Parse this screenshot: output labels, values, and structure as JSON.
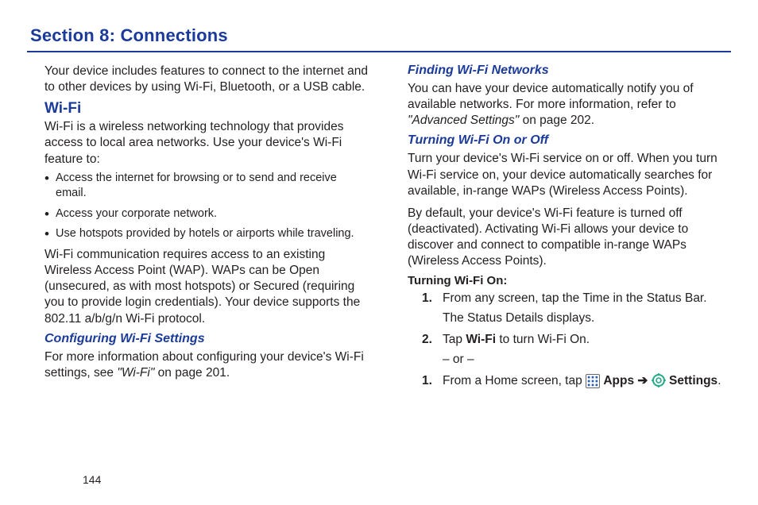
{
  "section": {
    "title": "Section 8: Connections"
  },
  "col1": {
    "intro": "Your device includes features to connect to the internet and to other devices by using Wi-Fi, Bluetooth, or a USB cable.",
    "wifi_h": "Wi-Fi",
    "wifi_p1": "Wi-Fi is a wireless networking technology that provides access to local area networks. Use your device's Wi-Fi feature to:",
    "bullets": [
      "Access the internet for browsing or to send and receive email.",
      "Access your corporate network.",
      "Use hotspots provided by hotels or airports while traveling."
    ],
    "wifi_p2": "Wi-Fi communication requires access to an existing Wireless Access Point (WAP). WAPs can be Open (unsecured, as with most hotspots) or Secured (requiring you to provide login credentials). Your device supports the 802.11 a/b/g/n Wi-Fi protocol.",
    "conf_h": "Configuring Wi-Fi Settings",
    "conf_p_a": "For more information about configuring your device's Wi-Fi settings, see ",
    "conf_ref": "\"Wi-Fi\"",
    "conf_p_b": " on page 201."
  },
  "col2": {
    "find_h": "Finding Wi-Fi Networks",
    "find_p_a": "You can have your device automatically notify you of available networks. For more information, refer to ",
    "find_ref": "\"Advanced Settings\"",
    "find_p_b": "  on page 202.",
    "turn_h": "Turning Wi-Fi On or Off",
    "turn_p1": "Turn your device's Wi-Fi service on or off. When you turn Wi-Fi service on, your device automatically searches for available, in-range WAPs (Wireless Access Points).",
    "turn_p2": "By default, your device's Wi-Fi feature is turned off (deactivated). Activating Wi-Fi allows your device to discover and connect to compatible in-range WAPs (Wireless Access Points).",
    "turn_on_h": "Turning Wi-Fi On:",
    "steps1": {
      "s1_num": "1.",
      "s1": "From any screen, tap the Time in the Status Bar.",
      "s1b": "The Status Details displays.",
      "s2_num": "2.",
      "s2_a": "Tap ",
      "s2_bold": "Wi-Fi",
      "s2_b": " to turn Wi-Fi On.",
      "s2_or": "– or –"
    },
    "steps2": {
      "s1_num": "1.",
      "s1_a": "From a Home screen, tap ",
      "apps_label": "Apps",
      "arrow": " ➔ ",
      "settings_label": "Settings",
      "period": "."
    }
  },
  "pagenum": "144"
}
